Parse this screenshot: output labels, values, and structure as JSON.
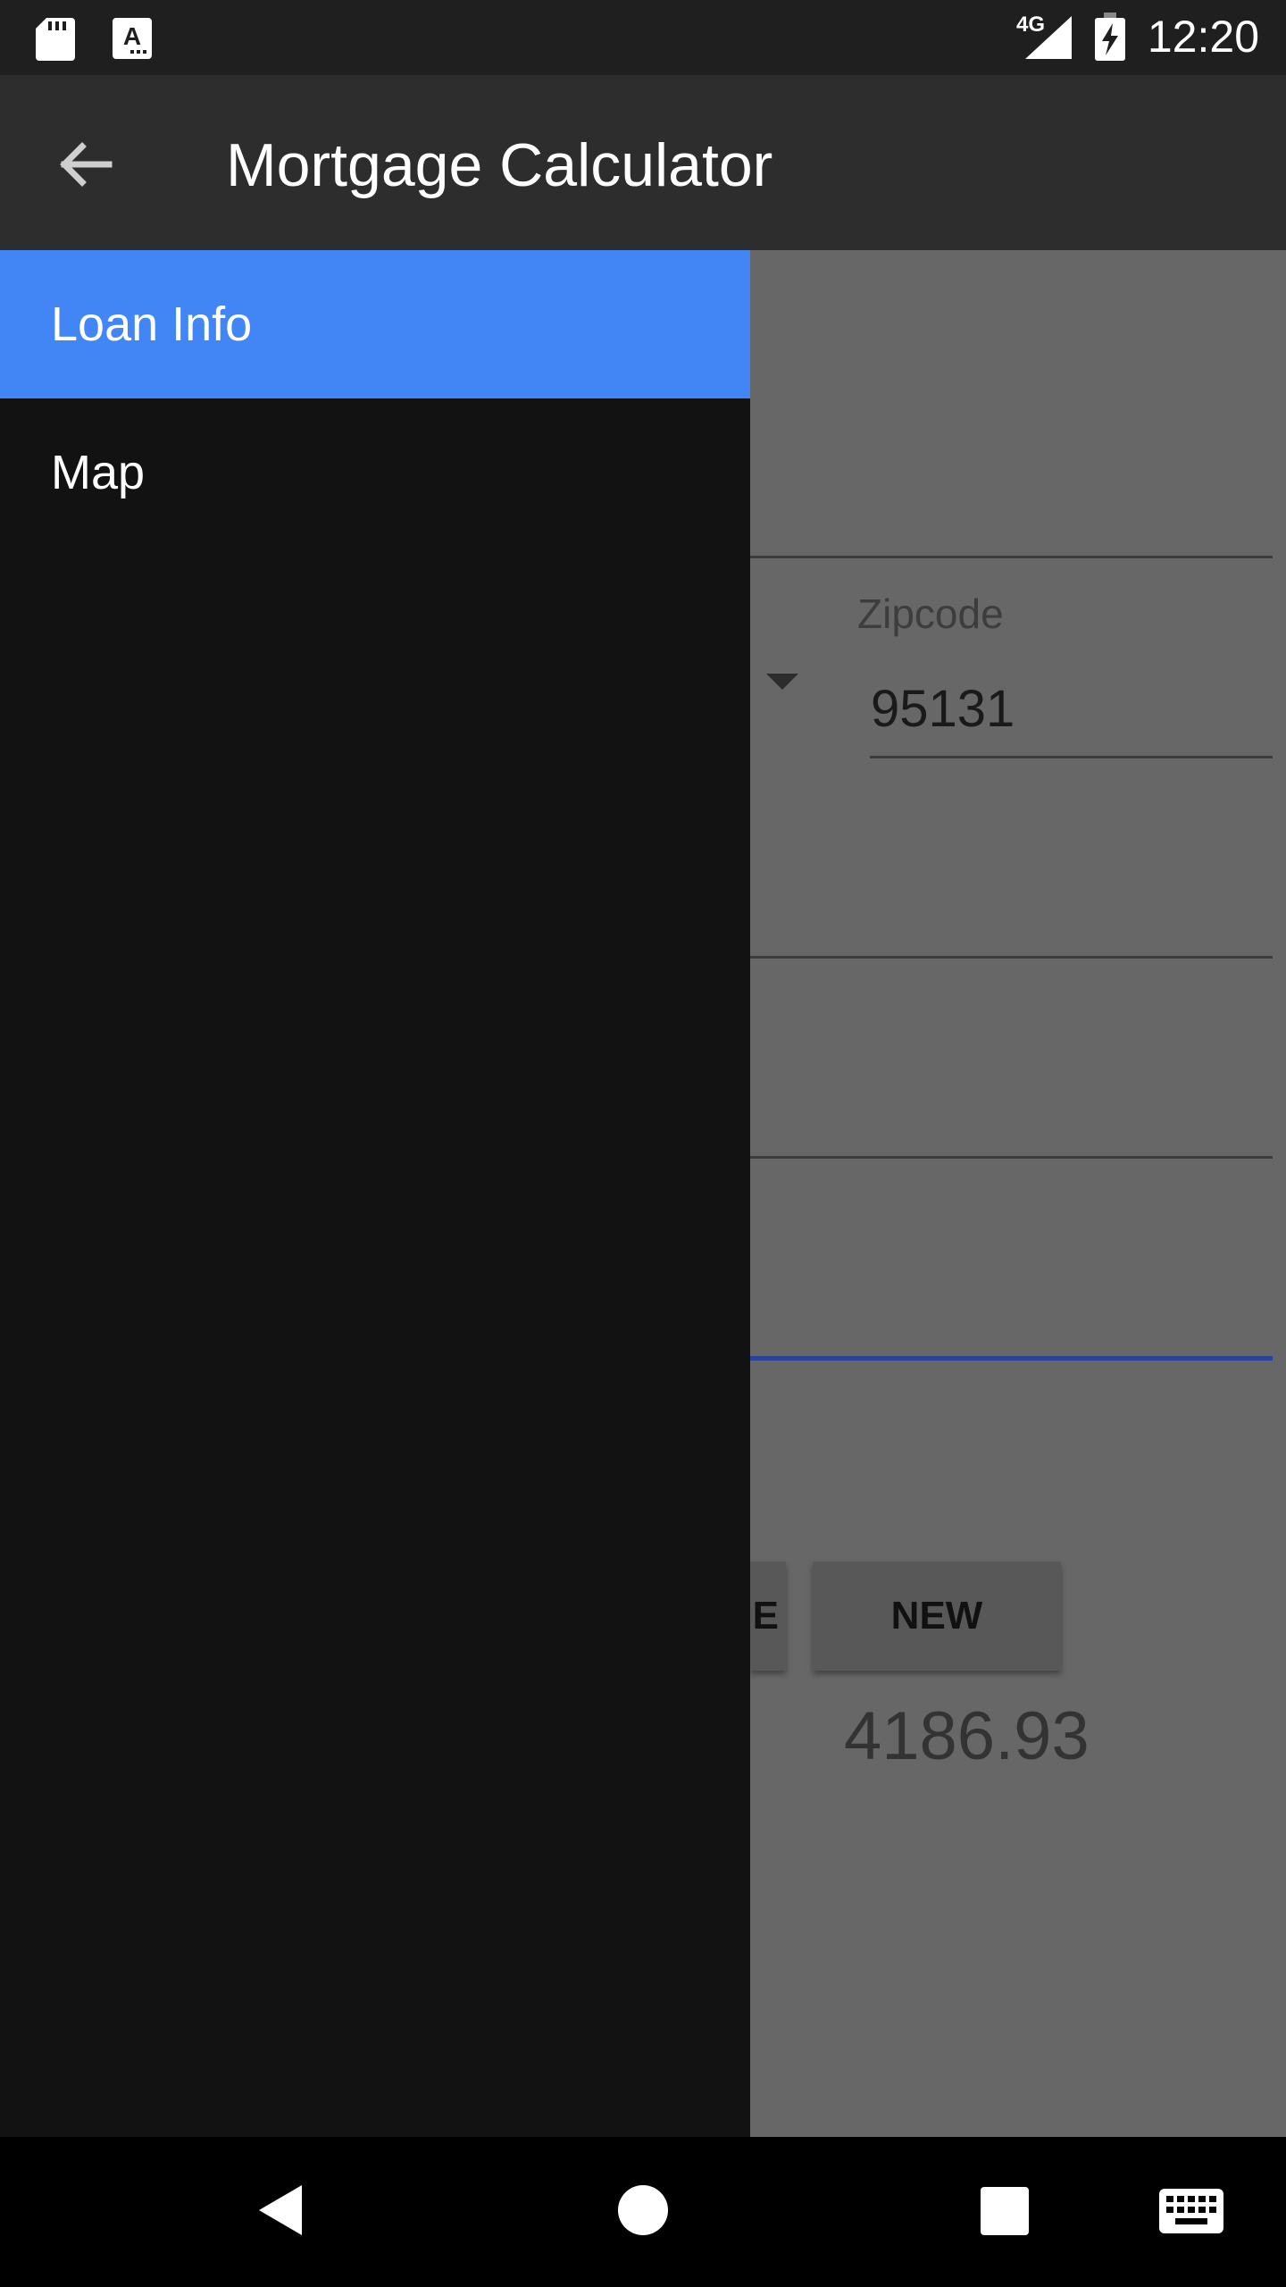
{
  "status_bar": {
    "time": "12:20",
    "network": "4G",
    "icons": [
      "sd-card-icon",
      "keyboard-a-icon",
      "signal-icon",
      "battery-charging-icon"
    ]
  },
  "app_bar": {
    "title": "Mortgage Calculator",
    "back_icon": "arrow-back-icon"
  },
  "drawer": {
    "items": [
      {
        "label": "Loan Info",
        "selected": true
      },
      {
        "label": "Map",
        "selected": false
      }
    ]
  },
  "form": {
    "zipcode_label": "Zipcode",
    "zipcode_value": "95131",
    "save_button_partial": "E",
    "new_button": "NEW",
    "result": "4186.93"
  },
  "colors": {
    "drawer_selected": "#4285f4",
    "drawer_bg": "#121212",
    "app_bar": "#2d2d2d",
    "status_bar": "#1f1f1f",
    "accent_line": "#27439a"
  },
  "nav_bar": {
    "icons": [
      "back-triangle-icon",
      "home-circle-icon",
      "recents-square-icon",
      "keyboard-icon"
    ]
  }
}
